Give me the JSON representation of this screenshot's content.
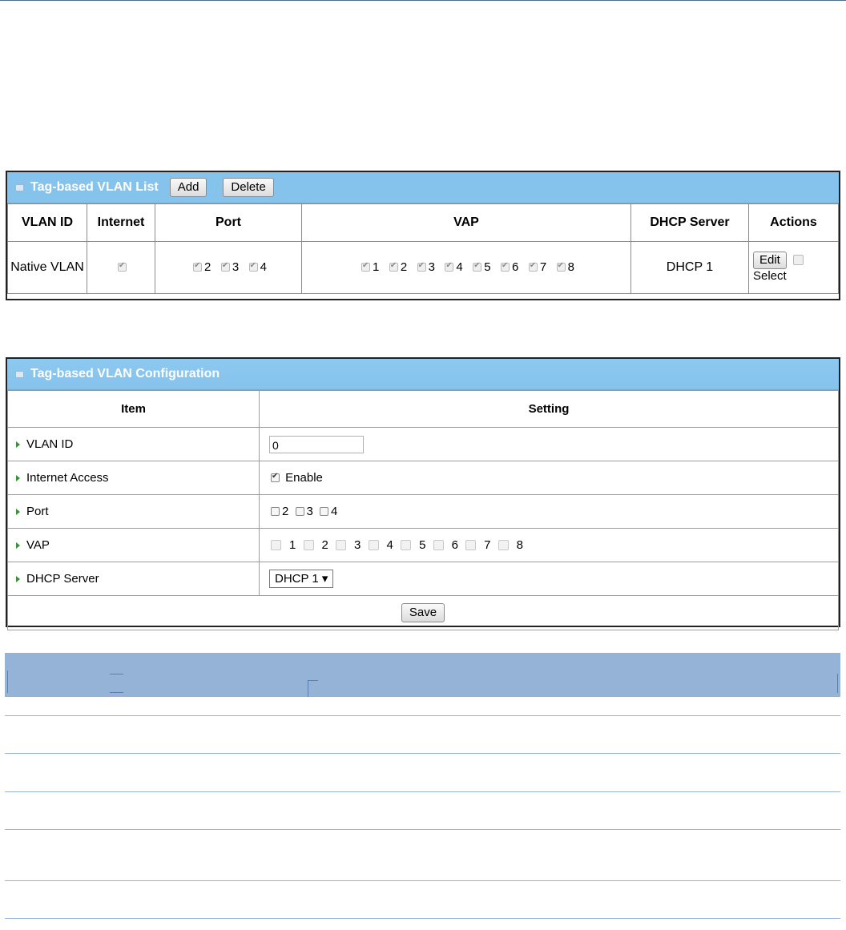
{
  "list_panel": {
    "title": "Tag-based VLAN List",
    "add_label": "Add",
    "delete_label": "Delete",
    "columns": [
      "VLAN ID",
      "Internet",
      "Port",
      "VAP",
      "DHCP Server",
      "Actions"
    ],
    "row": {
      "vlan_id": "Native VLAN",
      "internet_checked": true,
      "ports": [
        "2",
        "3",
        "4"
      ],
      "vaps": [
        "1",
        "2",
        "3",
        "4",
        "5",
        "6",
        "7",
        "8"
      ],
      "dhcp": "DHCP 1",
      "edit_label": "Edit",
      "select_label": "Select"
    }
  },
  "config_panel": {
    "title": "Tag-based VLAN Configuration",
    "col_item": "Item",
    "col_setting": "Setting",
    "vlan_id_label": "VLAN ID",
    "vlan_id_value": "0",
    "internet_label": "Internet Access",
    "internet_enable": "Enable",
    "port_label": "Port",
    "ports": [
      "2",
      "3",
      "4"
    ],
    "vap_label": "VAP",
    "vaps": [
      "1",
      "2",
      "3",
      "4",
      "5",
      "6",
      "7",
      "8"
    ],
    "dhcp_label": "DHCP Server",
    "dhcp_value": "DHCP 1 ▾",
    "save_label": "Save"
  }
}
